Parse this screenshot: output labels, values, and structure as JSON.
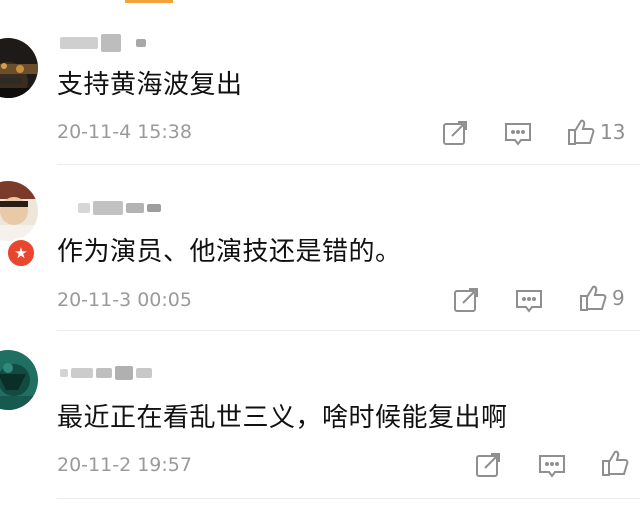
{
  "comments": [
    {
      "text": "支持黄海波复出",
      "time": "20-11-4 15:38",
      "likes": "13",
      "icons": [
        "repost-icon",
        "comment-icon",
        "thumbs-up-icon"
      ]
    },
    {
      "text": "作为演员、他演技还是错的。",
      "time": "20-11-3 00:05",
      "likes": "9",
      "icons": [
        "repost-icon",
        "comment-icon",
        "thumbs-up-icon"
      ]
    },
    {
      "text": "最近正在看乱世三义，啥时候能复出啊",
      "time": "20-11-2 19:57",
      "likes": "",
      "icons": [
        "repost-icon",
        "comment-icon",
        "thumbs-up-icon"
      ]
    }
  ],
  "colors": {
    "text": "#111111",
    "meta": "#9a9a9a",
    "icon": "#8f8f8f",
    "badge": "#e9462f"
  }
}
